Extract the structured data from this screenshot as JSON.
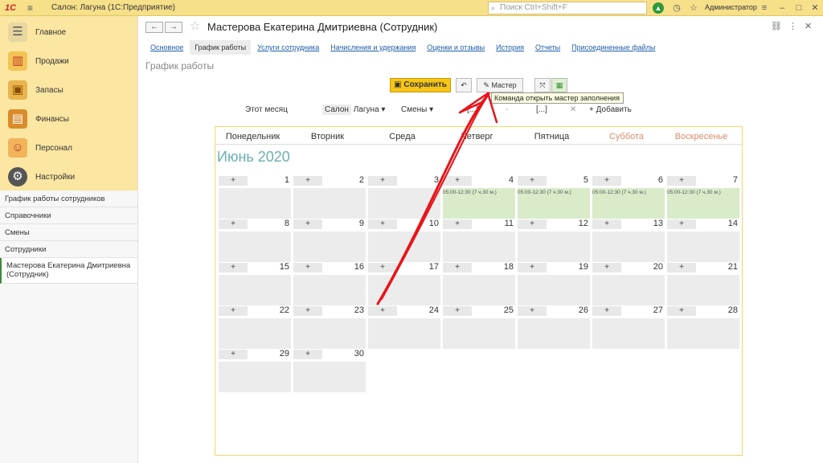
{
  "app": {
    "title": "Салон: Лагуна  (1С:Предприятие)",
    "logo": "1С"
  },
  "search": {
    "placeholder": "Поиск Ctrl+Shift+F"
  },
  "user": {
    "name": "Администратор"
  },
  "sidebar": {
    "main": [
      {
        "label": "Главное",
        "icon": "list-icon"
      },
      {
        "label": "Продажи",
        "icon": "chart-icon"
      },
      {
        "label": "Запасы",
        "icon": "box-icon"
      },
      {
        "label": "Финансы",
        "icon": "wallet-icon"
      },
      {
        "label": "Персонал",
        "icon": "people-icon"
      },
      {
        "label": "Настройки",
        "icon": "gear-icon"
      }
    ],
    "sub": [
      "График работы сотрудников",
      "Справочники",
      "Смены",
      "Сотрудники",
      "Мастерова Екатерина Дмитриевна (Сотрудник)"
    ]
  },
  "document": {
    "title": "Мастерова Екатерина Дмитриевна (Сотрудник)",
    "tabs": [
      "Основное",
      "График работы",
      "Услуги сотрудника",
      "Начисления и удержания",
      "Оценки и отзывы",
      "История",
      "Отчеты",
      "Присоединенные файлы"
    ],
    "section_title": "График работы"
  },
  "toolbar": {
    "save": "Сохранить",
    "master": "Мастер",
    "tooltip": "Команда открыть мастер заполнения"
  },
  "filters": {
    "period": "Этот месяц",
    "salon_label": "Салон",
    "salon_value": "Лагуна",
    "shifts": "Смены",
    "range_from": "[...]",
    "range_sep": "-",
    "range_to": "[...]",
    "add": "+ Добавить"
  },
  "calendar": {
    "month": "Июнь 2020",
    "weekdays": [
      "Понедельник",
      "Вторник",
      "Среда",
      "Четверг",
      "Пятница",
      "Суббота",
      "Воскресенье"
    ],
    "shift_text": "05:00-12:30 (7 ч.30 м.)",
    "days": [
      {
        "d": "1",
        "work": false
      },
      {
        "d": "2",
        "work": false
      },
      {
        "d": "3",
        "work": false
      },
      {
        "d": "4",
        "work": true
      },
      {
        "d": "5",
        "work": true
      },
      {
        "d": "6",
        "work": true
      },
      {
        "d": "7",
        "work": true
      },
      {
        "d": "8",
        "work": false
      },
      {
        "d": "9",
        "work": false
      },
      {
        "d": "10",
        "work": false
      },
      {
        "d": "11",
        "work": false
      },
      {
        "d": "12",
        "work": false
      },
      {
        "d": "13",
        "work": false
      },
      {
        "d": "14",
        "work": false
      },
      {
        "d": "15",
        "work": false
      },
      {
        "d": "16",
        "work": false
      },
      {
        "d": "17",
        "work": false
      },
      {
        "d": "18",
        "work": false
      },
      {
        "d": "19",
        "work": false
      },
      {
        "d": "20",
        "work": false
      },
      {
        "d": "21",
        "work": false
      },
      {
        "d": "22",
        "work": false
      },
      {
        "d": "23",
        "work": false
      },
      {
        "d": "24",
        "work": false
      },
      {
        "d": "25",
        "work": false
      },
      {
        "d": "26",
        "work": false
      },
      {
        "d": "27",
        "work": false
      },
      {
        "d": "28",
        "work": false
      },
      {
        "d": "29",
        "work": false
      },
      {
        "d": "30",
        "work": false
      }
    ]
  }
}
